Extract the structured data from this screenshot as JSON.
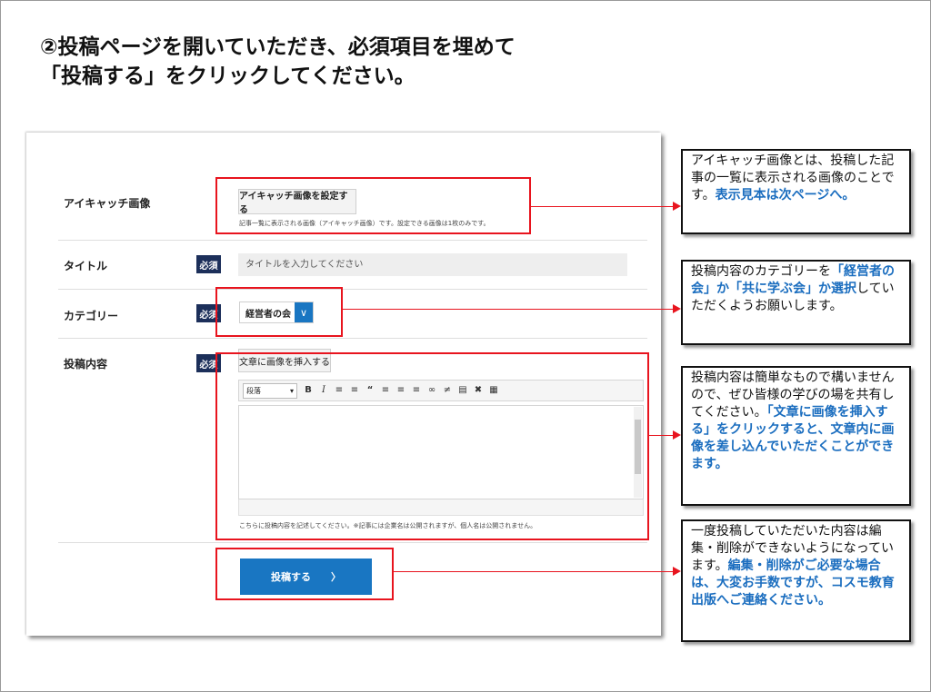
{
  "heading": {
    "line1": "②投稿ページを開いていただき、必須項目を埋めて",
    "line2": "「投稿する」をクリックしてください。"
  },
  "form": {
    "eyecatch": {
      "label": "アイキャッチ画像",
      "button_label": "アイキャッチ画像を設定する",
      "note": "記事一覧に表示される画像（アイキャッチ画像）です。設定できる画像は1枚のみです。"
    },
    "title": {
      "label": "タイトル",
      "required_badge": "必須",
      "placeholder": "タイトルを入力してください"
    },
    "category": {
      "label": "カテゴリー",
      "required_badge": "必須",
      "selected_value": "経営者の会"
    },
    "content": {
      "label": "投稿内容",
      "required_badge": "必須",
      "insert_image_button": "文章に画像を挿入する",
      "format_select": "段落",
      "note": "こちらに投稿内容を記述してください。※記事には企業名は公開されますが、個人名は公開されません。"
    },
    "submit": {
      "label": "投稿する",
      "arrow": "〉"
    }
  },
  "callouts": {
    "eyecatch": {
      "plain": "アイキャッチ画像とは、投稿した記事の一覧に表示される画像のことです。",
      "bold": "表示見本は次ページへ。"
    },
    "category": {
      "plain1": "投稿内容のカテゴリーを",
      "bold": "「経営者の会」か「共に学ぶ会」か選択",
      "plain2": "していただくようお願いします。"
    },
    "content": {
      "plain": "投稿内容は簡単なもので構いませんので、ぜひ皆様の学びの場を共有してください。",
      "bold": "「文章に画像を挿入する」をクリックすると、文章内に画像を差し込んでいただくことができます。"
    },
    "submit": {
      "plain": "一度投稿していただいた内容は編集・削除ができないようになっています。",
      "bold": "編集・削除がご必要な場合は、大変お手数ですが、コスモ教育出版へご連絡ください。"
    }
  },
  "colors": {
    "accent_blue": "#1976c2",
    "highlight_red": "#e8141e",
    "badge_navy": "#1c2f5a",
    "callout_blue_text": "#1a6dbf"
  }
}
